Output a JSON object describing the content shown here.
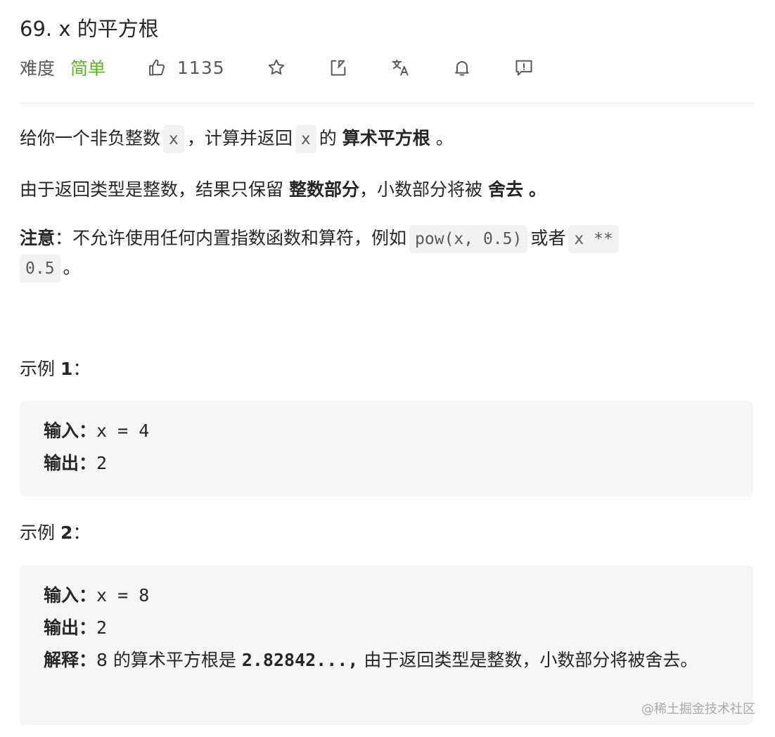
{
  "problem": {
    "title": "69. x 的平方根",
    "difficulty_label": "难度",
    "difficulty": "简单",
    "likes": "1135"
  },
  "icons": {
    "like": "thumbs-up-icon",
    "star": "star-icon",
    "share": "share-icon",
    "translate": "translate-icon",
    "bell": "bell-icon",
    "feedback": "feedback-icon"
  },
  "description": {
    "p1": {
      "a": "给你一个非负整数",
      "code1": "x",
      "b": "，计算并返回",
      "code2": "x",
      "c": "的",
      "bold": "算术平方根",
      "d": "。"
    },
    "p2": {
      "a": "由于返回类型是整数，结果只保留",
      "bold1": "整数部分",
      "b": "，小数部分将被",
      "bold2": "舍去",
      "c": "。"
    },
    "p3": {
      "label": "注意",
      "a": "：不允许使用任何内置指数函数和算符，例如",
      "code1": "pow(x, 0.5)",
      "b": "或者",
      "code2a": "x **",
      "code2b": "0.5",
      "c": "。"
    }
  },
  "examples": [
    {
      "heading": "示例",
      "num": "1",
      "colon": "：",
      "input_label": "输入：",
      "input_value": "x = 4",
      "output_label": "输出：",
      "output_value": "2"
    },
    {
      "heading": "示例",
      "num": "2",
      "colon": "：",
      "input_label": "输入：",
      "input_value": "x = 8",
      "output_label": "输出：",
      "output_value": "2",
      "explain_label": "解释：",
      "explain_a": "8 的算术平方根是",
      "explain_code": "2.82842...,",
      "explain_b": "由于返回类型是整数，小数部分将被舍去。"
    }
  ],
  "watermark": "@稀土掘金技术社区",
  "colors": {
    "easy": "#5ab726",
    "code_bg": "#f2f2f2",
    "example_bg": "#f6f6f6",
    "text": "#262626",
    "muted": "#595959"
  }
}
